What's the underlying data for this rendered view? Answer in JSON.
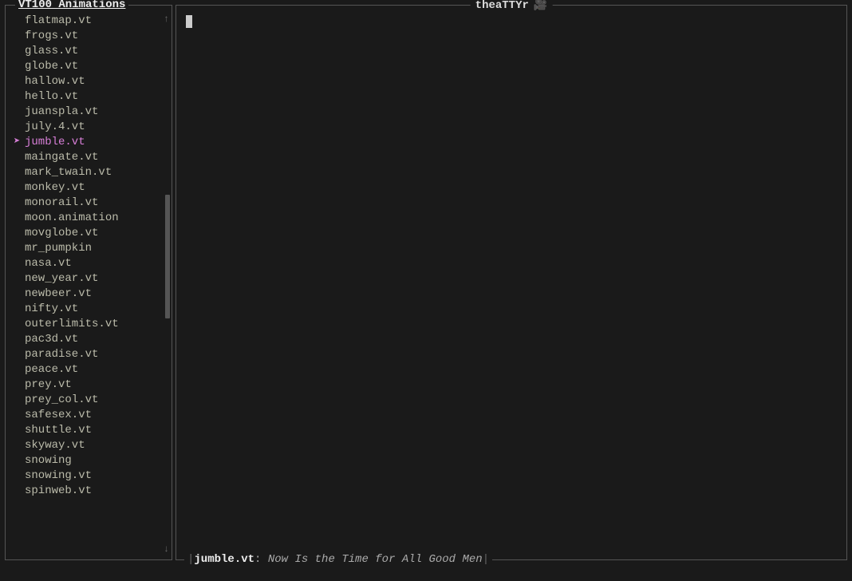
{
  "sidebar": {
    "title": "VT100 Animations",
    "selected_index": 8,
    "scroll": {
      "up_arrow": "↑",
      "down_arrow": "↓",
      "thumb_top_pct": 33,
      "thumb_height_pct": 24
    },
    "items": [
      "flatmap.vt",
      "frogs.vt",
      "glass.vt",
      "globe.vt",
      "hallow.vt",
      "hello.vt",
      "juanspla.vt",
      "july.4.vt",
      "jumble.vt",
      "maingate.vt",
      "mark_twain.vt",
      "monkey.vt",
      "monorail.vt",
      "moon.animation",
      "movglobe.vt",
      "mr_pumpkin",
      "nasa.vt",
      "new_year.vt",
      "newbeer.vt",
      "nifty.vt",
      "outerlimits.vt",
      "pac3d.vt",
      "paradise.vt",
      "peace.vt",
      "prey.vt",
      "prey_col.vt",
      "safesex.vt",
      "shuttle.vt",
      "skyway.vt",
      "snowing",
      "snowing.vt",
      "spinweb.vt"
    ]
  },
  "main": {
    "title": "theaTTYr",
    "camera_glyph": "🎥"
  },
  "status": {
    "pipe": "|",
    "filename": "jumble.vt",
    "separator": ":",
    "description": "Now Is the Time for All Good Men"
  },
  "selector_marker": "➤"
}
